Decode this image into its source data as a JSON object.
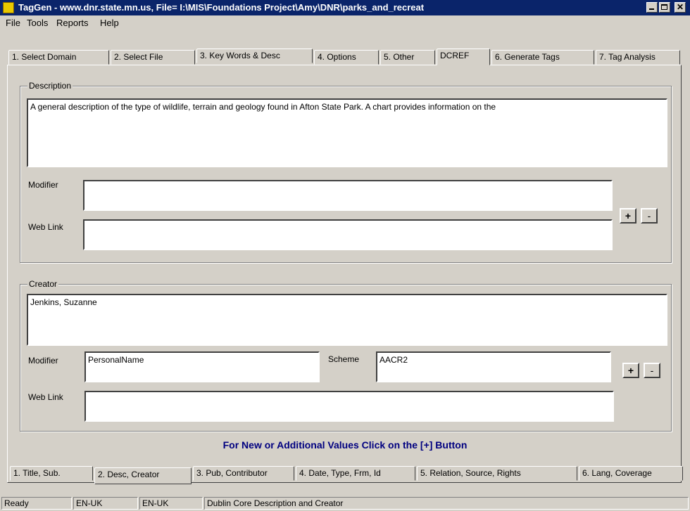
{
  "window": {
    "title": "TagGen - www.dnr.state.mn.us, File= I:\\MIS\\Foundations Project\\Amy\\DNR\\parks_and_recreat"
  },
  "menu": [
    "File",
    "Tools",
    "Reports",
    "Help"
  ],
  "top_tabs": [
    "1. Select Domain",
    "2. Select File",
    "3. Key Words & Desc",
    "4. Options",
    "5. Other",
    "DCREF",
    "6. Generate Tags",
    "7. Tag Analysis"
  ],
  "top_tabs_active": "DCREF",
  "description": {
    "legend": "Description",
    "text": "A general description of the type of wildlife, terrain and geology found in Afton State Park. A chart provides information on the",
    "modifier_label": "Modifier",
    "modifier_value": "",
    "weblink_label": "Web Link",
    "weblink_value": "",
    "add_label": "+",
    "remove_label": "-"
  },
  "creator": {
    "legend": "Creator",
    "text": "Jenkins, Suzanne",
    "modifier_label": "Modifier",
    "modifier_value": "PersonalName",
    "scheme_label": "Scheme",
    "scheme_value": "AACR2",
    "weblink_label": "Web Link",
    "weblink_value": "",
    "add_label": "+",
    "remove_label": "-"
  },
  "hint": "For New or Additional Values Click on the [+] Button",
  "bottom_tabs": [
    "1. Title, Sub.",
    "2. Desc, Creator",
    "3. Pub, Contributor",
    "4. Date, Type, Frm, Id",
    "5. Relation, Source, Rights",
    "6. Lang, Coverage"
  ],
  "bottom_tabs_active": "2. Desc, Creator",
  "status": [
    "Ready",
    "EN-UK",
    "EN-UK",
    "Dublin Core Description and Creator"
  ],
  "colors": {
    "titlebar": "#0a246a",
    "hint": "#000080",
    "face": "#d4d0c8"
  }
}
